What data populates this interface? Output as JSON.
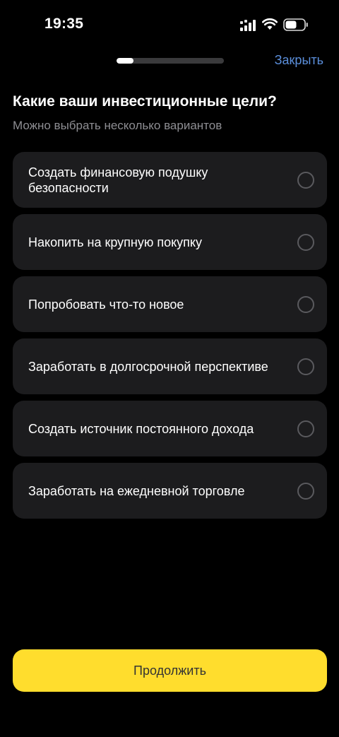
{
  "status_bar": {
    "time": "19:35",
    "icons": [
      "signal-icon",
      "wifi-icon",
      "battery-icon"
    ]
  },
  "header": {
    "progress": 0.16,
    "close_label": "Закрыть"
  },
  "question": {
    "title": "Какие ваши инвестиционные цели?",
    "subtitle": "Можно выбрать несколько вариантов"
  },
  "options": [
    {
      "label": "Создать финансовую подушку безопасности",
      "selected": false
    },
    {
      "label": "Накопить на крупную покупку",
      "selected": false
    },
    {
      "label": "Попробовать что-то новое",
      "selected": false
    },
    {
      "label": "Заработать в долгосрочной перспективе",
      "selected": false
    },
    {
      "label": "Создать источник постоянного дохода",
      "selected": false
    },
    {
      "label": "Заработать на ежедневной торговле",
      "selected": false
    }
  ],
  "continue_label": "Продолжить",
  "colors": {
    "background": "#000000",
    "card": "#1c1c1e",
    "accent_link": "#5b8fdc",
    "primary_button": "#ffdd2d",
    "secondary_text": "#8e8e93"
  }
}
